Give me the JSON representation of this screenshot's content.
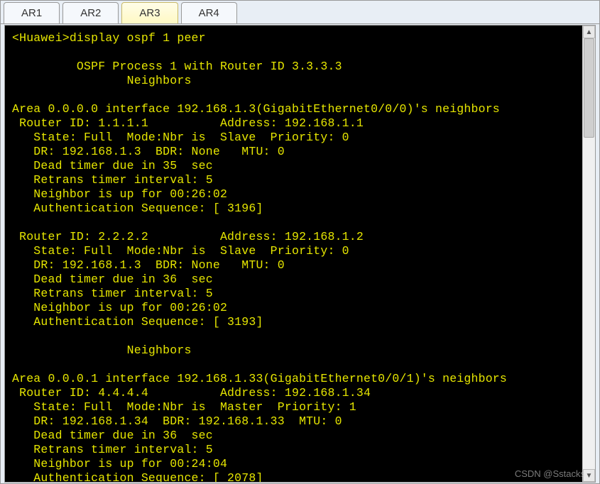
{
  "tabs": [
    {
      "label": "AR1",
      "active": false
    },
    {
      "label": "AR2",
      "active": false
    },
    {
      "label": "AR3",
      "active": true
    },
    {
      "label": "AR4",
      "active": false
    }
  ],
  "scrollbar": {
    "up": "▲",
    "down": "▼"
  },
  "watermark": "CSDN @Sstacks",
  "cli": {
    "prompt": "<Huawei>display ospf 1 peer",
    "header1": "         OSPF Process 1 with Router ID 3.3.3.3",
    "header2": "                Neighbors",
    "area0_line": "Area 0.0.0.0 interface 192.168.1.3(GigabitEthernet0/0/0)'s neighbors",
    "n1": {
      "rid": " Router ID: 1.1.1.1          Address: 192.168.1.1",
      "state": "   State: Full  Mode:Nbr is  Slave  Priority: 0",
      "dr": "   DR: 192.168.1.3  BDR: None   MTU: 0",
      "dead": "   Dead timer due in 35  sec",
      "retrans": "   Retrans timer interval: 5",
      "up": "   Neighbor is up for 00:26:02",
      "auth": "   Authentication Sequence: [ 3196]"
    },
    "n2": {
      "rid": " Router ID: 2.2.2.2          Address: 192.168.1.2",
      "state": "   State: Full  Mode:Nbr is  Slave  Priority: 0",
      "dr": "   DR: 192.168.1.3  BDR: None   MTU: 0",
      "dead": "   Dead timer due in 36  sec",
      "retrans": "   Retrans timer interval: 5",
      "up": "   Neighbor is up for 00:26:02",
      "auth": "   Authentication Sequence: [ 3193]"
    },
    "header3": "                Neighbors",
    "area1_line": "Area 0.0.0.1 interface 192.168.1.33(GigabitEthernet0/0/1)'s neighbors",
    "n3": {
      "rid": " Router ID: 4.4.4.4          Address: 192.168.1.34",
      "state": "   State: Full  Mode:Nbr is  Master  Priority: 1",
      "dr": "   DR: 192.168.1.34  BDR: 192.168.1.33  MTU: 0",
      "dead": "   Dead timer due in 36  sec",
      "retrans": "   Retrans timer interval: 5",
      "up": "   Neighbor is up for 00:24:04",
      "auth": "   Authentication Sequence: [ 2078]"
    }
  }
}
